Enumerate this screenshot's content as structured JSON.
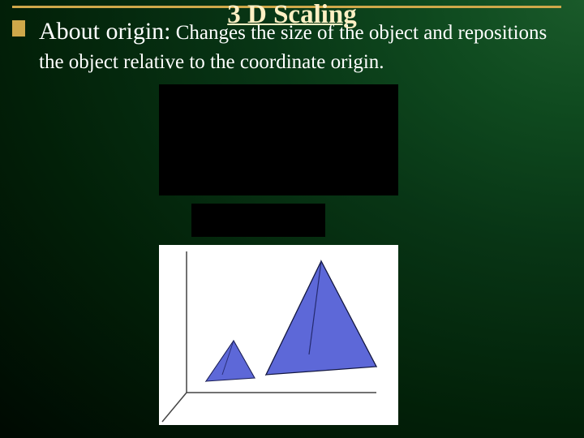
{
  "slide": {
    "title": "3 D Scaling",
    "bullet_strong": "About origin:",
    "bullet_rest": " Changes the size of the object and repositions the object relative to the coordinate origin."
  }
}
